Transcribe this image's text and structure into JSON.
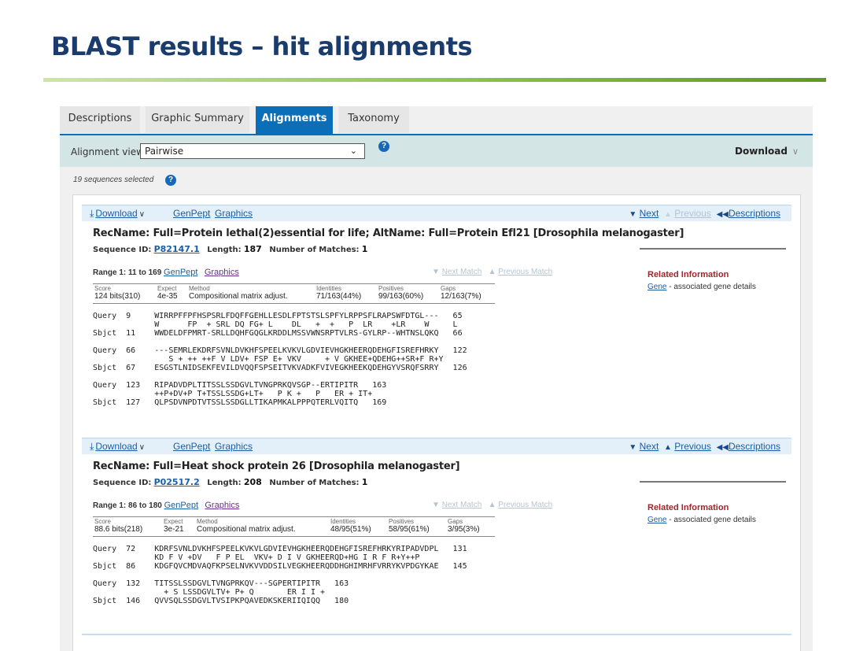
{
  "slide": {
    "title": "BLAST results – hit alignments"
  },
  "tabs": [
    "Descriptions",
    "Graphic Summary",
    "Alignments",
    "Taxonomy"
  ],
  "view_bar": {
    "label": "Alignment view",
    "select_value": "Pairwise",
    "download_label": "Download"
  },
  "sequences_selected": "19 sequences selected",
  "toolbar": {
    "download": "Download",
    "genpept": "GenPept",
    "graphics": "Graphics",
    "next": "Next",
    "previous": "Previous",
    "descriptions": "Descriptions"
  },
  "meta_labels": {
    "sequence_id": "Sequence ID:",
    "length": "Length:",
    "matches": "Number of Matches:"
  },
  "stat_headers": {
    "score": "Score",
    "expect": "Expect",
    "method": "Method",
    "identities": "Identities",
    "positives": "Positives",
    "gaps": "Gaps"
  },
  "match_nav": {
    "next": "Next Match",
    "previous": "Previous Match"
  },
  "related": {
    "title": "Related Information",
    "gene_link": "Gene",
    "gene_desc": " - associated gene details"
  },
  "hits": [
    {
      "title": "RecName: Full=Protein lethal(2)essential for life; AltName: Full=Protein Efl21 [Drosophila melanogaster]",
      "sequence_id": "P82147.1",
      "length": "187",
      "matches": "1",
      "previous_enabled": false,
      "range": "Range 1: 11 to 169",
      "score": "124 bits(310)",
      "expect": "4e-35",
      "method": "Compositional matrix adjust.",
      "identities": "71/163(44%)",
      "positives": "99/163(60%)",
      "gaps": "12/163(7%)",
      "alignment": "Query  9     WIRRPFFPFHSPSRLFDQFFGEHLLESDLFPTSTSLSPFYLRPPSFLRAPSWFDTGL---   65\n             W      FP  + SRL DQ FG+ L    DL   +  +   P  LR    +LR    W     L\nSbjct  11    WWDELDFPMRT-SRLLDQHFGQGLKRDDLMSSVWNSRPTVLRS-GYLRP--WHTNSLQKQ   66\n\nQuery  66    ---SEMRLEKDRFSVNLDVKHFSPEELKVKVLGDVIEVHGKHEERQDEHGFISREFHRKY   122\n                S + ++ ++F V LDV+ FSP E+ VKV     + V GKHEE+QDEHG++SR+F R+Y\nSbjct  67    ESGSTLNIDSEKFEVILDVQQFSPSEITVKVADKFVIVEGKHEEKQDEHGYVSRQFSRRY   126\n\nQuery  123   RIPADVDPLTITSSLSSDGVLTVNGPRKQVSGP--ERTIPITR   163\n             ++P+DV+P T+TSSLSSDG+LT+   P K +   P   ER + IT+\nSbjct  127   QLPSDVNPDTVTSSLSSDGLLTIKAPMKALPPPQTERLVQITQ   169"
    },
    {
      "title": "RecName: Full=Heat shock protein 26 [Drosophila melanogaster]",
      "sequence_id": "P02517.2",
      "length": "208",
      "matches": "1",
      "previous_enabled": true,
      "range": "Range 1: 86 to 180",
      "score": "88.6 bits(218)",
      "expect": "3e-21",
      "method": "Compositional matrix adjust.",
      "identities": "48/95(51%)",
      "positives": "58/95(61%)",
      "gaps": "3/95(3%)",
      "alignment": "Query  72    KDRFSVNLDVKHFSPEELKVKVLGDVIEVHGKHEERQDEHGFISREFHRKYRIPADVDPL   131\n             KD F V +DV   F P EL  VKV+ D I V GKHEERQD+HG I R F R+Y++P\nSbjct  86    KDGFQVCMDVAQFKPSELNVKVVDDSILVEGKHEERQDDHGHIMRHFVRRYKVPDGYKAE   145\n\nQuery  132   TITSSLSSDGVLTVNGPRKQV---SGPERTIPITR   163\n               + S LSSDGVLTV+ P+ Q       ER I I +\nSbjct  146   QVVSQLSSDGVLTVSIPKPQAVEDKSKERIIQIQQ   180"
    }
  ]
}
